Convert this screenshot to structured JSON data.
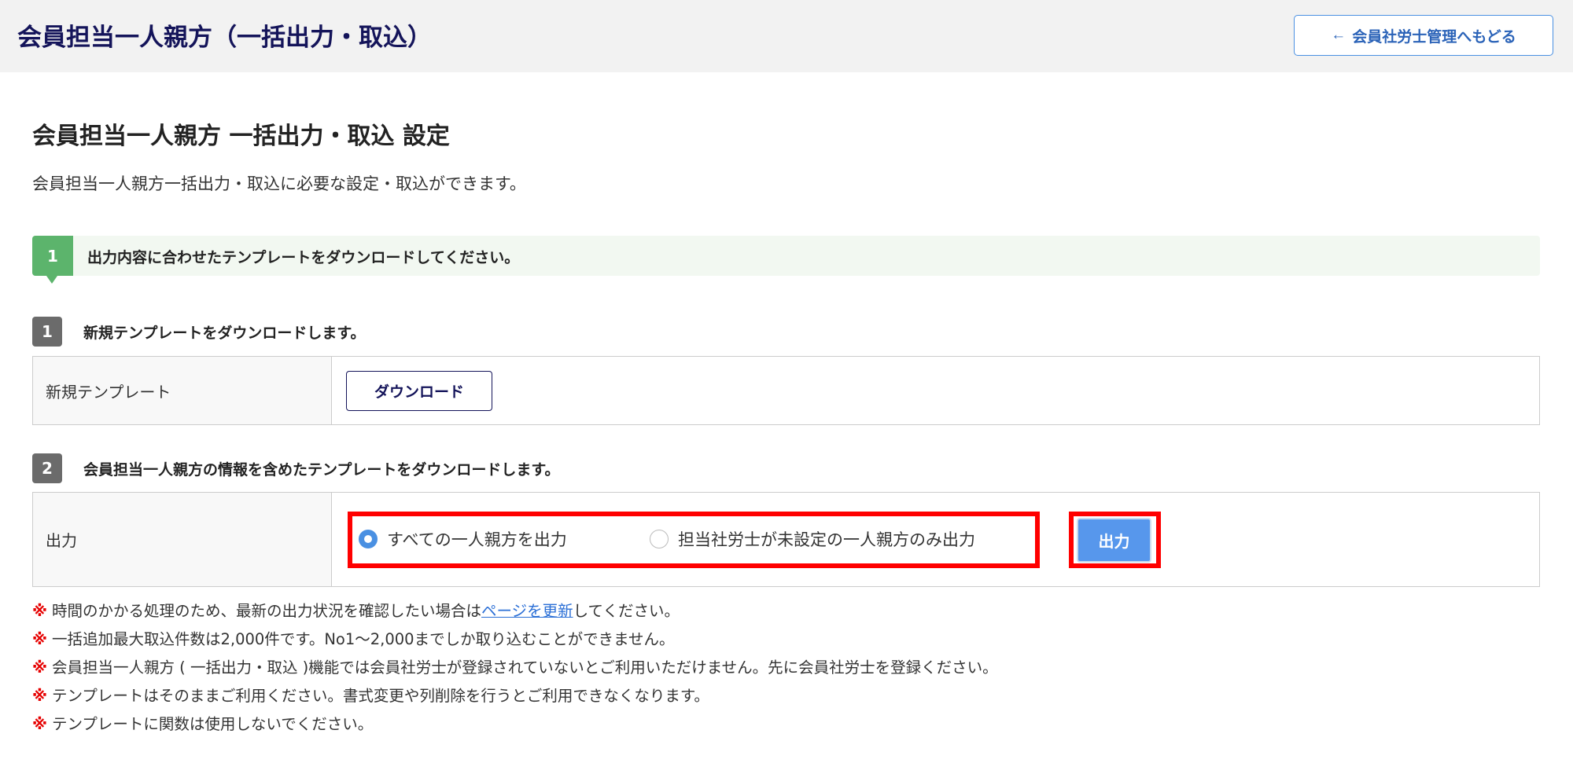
{
  "header": {
    "title": "会員担当一人親方（一括出力・取込）",
    "back_label": "会員社労士管理へもどる"
  },
  "page": {
    "heading": "会員担当一人親方 一括出力・取込 設定",
    "description": "会員担当一人親方一括出力・取込に必要な設定・取込ができます。"
  },
  "step": {
    "number": "1",
    "text": "出力内容に合わせたテンプレートをダウンロードしてください。"
  },
  "section1": {
    "number": "1",
    "title": "新規テンプレートをダウンロードします。",
    "row_label": "新規テンプレート",
    "button": "ダウンロード"
  },
  "section2": {
    "number": "2",
    "title": "会員担当一人親方の情報を含めたテンプレートをダウンロードします。",
    "row_label": "出力",
    "options": [
      {
        "label": "すべての一人親方を出力",
        "selected": true
      },
      {
        "label": "担当社労士が未設定の一人親方のみ出力",
        "selected": false
      }
    ],
    "button": "出力"
  },
  "notes": {
    "mark": "※",
    "n1_pre": "時間のかかる処理のため、最新の出力状況を確認したい場合は",
    "n1_link": "ページを更新",
    "n1_post": "してください。",
    "n2": "一括追加最大取込件数は2,000件です。No1～2,000までしか取り込むことができません。",
    "n3": "会員担当一人親方 ( 一括出力・取込 )機能では会員社労士が登録されていないとご利用いただけません。先に会員社労士を登録ください。",
    "n4": "テンプレートはそのままご利用ください。書式変更や列削除を行うとご利用できなくなります。",
    "n5": "テンプレートに関数は使用しないでください。"
  }
}
